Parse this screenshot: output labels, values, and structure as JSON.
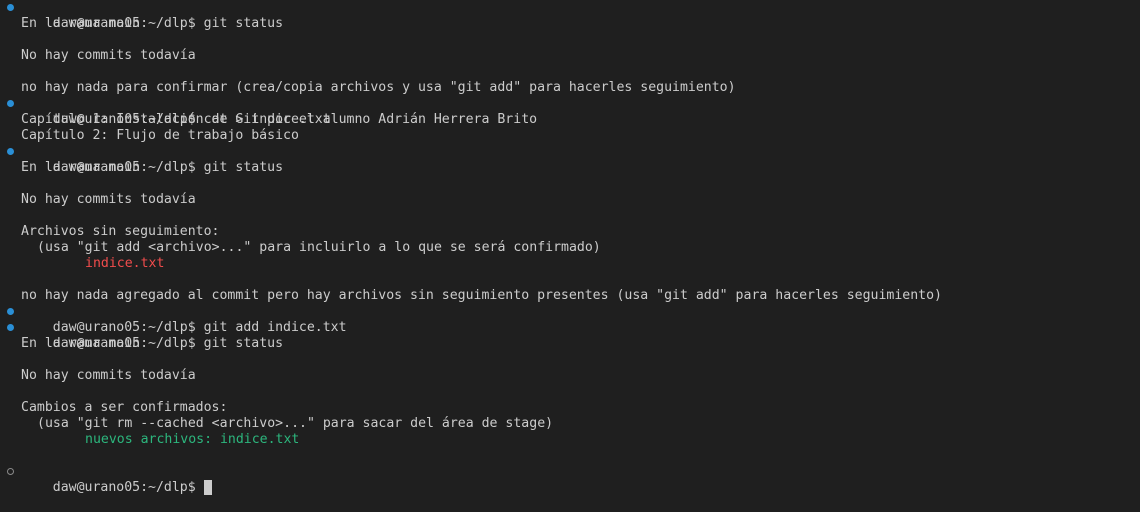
{
  "colors": {
    "background": "#1f1f1f",
    "foreground": "#cccccc",
    "untracked": "#f14c4c",
    "staged": "#2cb67d",
    "decoration_success": "#2a8fd6"
  },
  "terminal": {
    "prompt": "daw@urano05:~/dlp$",
    "blocks": {
      "b1": {
        "command": "git status",
        "out1": "En la rama main",
        "out2": "No hay commits todavía",
        "out3": "no hay nada para confirmar (crea/copia archivos y usa \"git add\" para hacerles seguimiento)"
      },
      "b2": {
        "command": "cat > indice.txt",
        "out1": "Capítulo 1: Instalación de Git por el alumno Adrián Herrera Brito",
        "out2": "Capítulo 2: Flujo de trabajo básico"
      },
      "b3": {
        "command": "git status",
        "out1": "En la rama main",
        "out2": "No hay commits todavía",
        "out3": "Archivos sin seguimiento:",
        "out4": "(usa \"git add <archivo>...\" para incluirlo a lo que se será confirmado)",
        "out5": "indice.txt",
        "out6": "no hay nada agregado al commit pero hay archivos sin seguimiento presentes (usa \"git add\" para hacerles seguimiento)"
      },
      "b4": {
        "command": "git add indice.txt"
      },
      "b5": {
        "command": "git status",
        "out1": "En la rama main",
        "out2": "No hay commits todavía",
        "out3": "Cambios a ser confirmados:",
        "out4": "(usa \"git rm --cached <archivo>...\" para sacar del área de stage)",
        "out5": "nuevos archivos: indice.txt"
      },
      "b6": {
        "command": ""
      }
    }
  }
}
